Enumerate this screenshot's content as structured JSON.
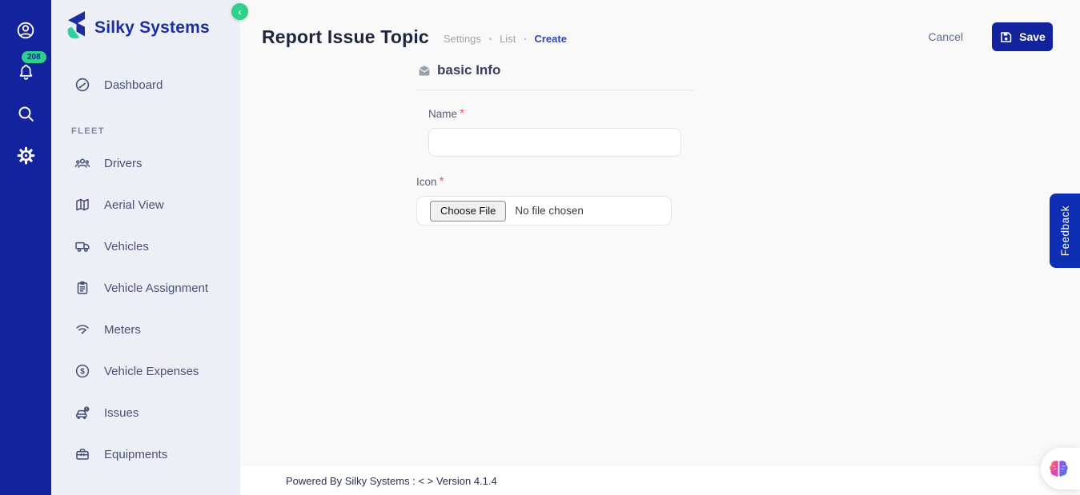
{
  "colors": {
    "primary_blue": "#13239e",
    "accent_green": "#2fd08c",
    "feedback_blue": "#0e2fb4",
    "breadcrumb_active": "#3347b0",
    "required_red": "#ee5a6a",
    "sidebar_bg": "#edeff6",
    "main_bg": "#f9f9fa"
  },
  "brand": {
    "name": "Silky Systems"
  },
  "rail": {
    "notification_count": "208"
  },
  "sidebar": {
    "collapse_glyph": "‹",
    "dashboard_label": "Dashboard",
    "section_label": "FLEET",
    "items": [
      {
        "label": "Drivers",
        "icon": "drivers-group-icon"
      },
      {
        "label": "Aerial View",
        "icon": "map-icon"
      },
      {
        "label": "Vehicles",
        "icon": "truck-icon"
      },
      {
        "label": "Vehicle Assignment",
        "icon": "clipboard-icon"
      },
      {
        "label": "Meters",
        "icon": "meter-signal-icon"
      },
      {
        "label": "Vehicle Expenses",
        "icon": "dollar-circle-icon"
      },
      {
        "label": "Issues",
        "icon": "car-alert-icon"
      },
      {
        "label": "Equipments",
        "icon": "toolbox-icon"
      }
    ]
  },
  "header": {
    "title": "Report Issue Topic",
    "breadcrumbs": [
      {
        "label": "Settings"
      },
      {
        "label": "List"
      },
      {
        "label": "Create"
      }
    ],
    "separator": "•",
    "cancel_label": "Cancel",
    "save_label": "Save"
  },
  "form": {
    "section_title": "basic Info",
    "required_marker": "*",
    "name_label": "Name",
    "name_value": "",
    "icon_label": "Icon",
    "file_button_label": "Choose File",
    "file_status": "No file chosen"
  },
  "footer": {
    "text": "Powered By Silky Systems : < > Version 4.1.4"
  },
  "feedback": {
    "label": "Feedback"
  }
}
